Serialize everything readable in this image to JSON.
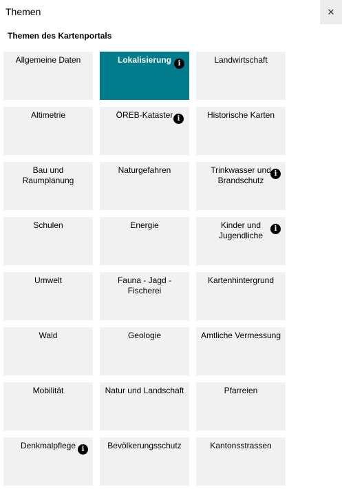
{
  "header": {
    "title": "Themen",
    "close_glyph": "✕"
  },
  "section": {
    "title": "Themen des Kartenportals"
  },
  "colors": {
    "active_tile": "#007c8c",
    "tile": "#f1f1f1",
    "info_badge": "#000000"
  },
  "info_glyph": "i",
  "tiles": [
    {
      "label": "Allgemeine Daten",
      "active": false,
      "info": false
    },
    {
      "label": "Lokalisierung",
      "active": true,
      "info": true
    },
    {
      "label": "Landwirtschaft",
      "active": false,
      "info": false
    },
    {
      "label": "Altimetrie",
      "active": false,
      "info": false
    },
    {
      "label": "ÖREB-Kataster",
      "active": false,
      "info": true
    },
    {
      "label": "Historische Karten",
      "active": false,
      "info": false
    },
    {
      "label": "Bau und Raumplanung",
      "active": false,
      "info": false
    },
    {
      "label": "Naturgefahren",
      "active": false,
      "info": false
    },
    {
      "label": "Trinkwasser und Brandschutz",
      "active": false,
      "info": true
    },
    {
      "label": "Schulen",
      "active": false,
      "info": false
    },
    {
      "label": "Energie",
      "active": false,
      "info": false
    },
    {
      "label": "Kinder und Jugendliche",
      "active": false,
      "info": true
    },
    {
      "label": "Umwelt",
      "active": false,
      "info": false
    },
    {
      "label": "Fauna - Jagd - Fischerei",
      "active": false,
      "info": false
    },
    {
      "label": "Kartenhintergrund",
      "active": false,
      "info": false
    },
    {
      "label": "Wald",
      "active": false,
      "info": false
    },
    {
      "label": "Geologie",
      "active": false,
      "info": false
    },
    {
      "label": "Amtliche Vermessung",
      "active": false,
      "info": false
    },
    {
      "label": "Mobilität",
      "active": false,
      "info": false
    },
    {
      "label": "Natur und Landschaft",
      "active": false,
      "info": false
    },
    {
      "label": "Pfarreien",
      "active": false,
      "info": false
    },
    {
      "label": "Denkmalpflege",
      "active": false,
      "info": true
    },
    {
      "label": "Bevölkerungsschutz",
      "active": false,
      "info": false
    },
    {
      "label": "Kantonsstrassen",
      "active": false,
      "info": false
    }
  ]
}
